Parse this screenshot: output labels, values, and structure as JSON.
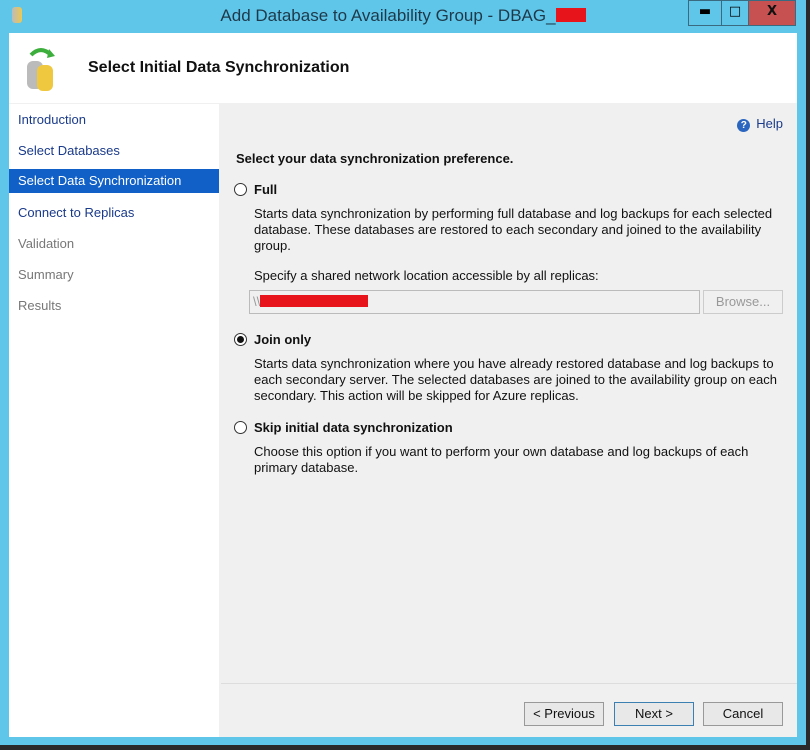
{
  "window": {
    "title": "Add Database to Availability Group - DBAG_",
    "minimize": "▬",
    "maximize": "□",
    "close": "X"
  },
  "header": {
    "title": "Select Initial Data Synchronization"
  },
  "nav": [
    "Introduction",
    "Select Databases",
    "Select Data Synchronization",
    "Connect to Replicas",
    "Validation",
    "Summary",
    "Results"
  ],
  "main": {
    "help": "Help",
    "prompt": "Select your data synchronization preference.",
    "full": {
      "label": "Full",
      "desc": "Starts data synchronization by performing full database and log backups for each selected database. These databases are restored to each secondary and joined to the availability group.",
      "share_label": "Specify a shared network location accessible by all replicas:",
      "share_value": "\\\\",
      "browse": "Browse..."
    },
    "join": {
      "label": "Join only",
      "desc": "Starts data synchronization where you have already restored database and log backups to each secondary server. The selected databases are joined to the availability group on each secondary. This action will be skipped for Azure replicas."
    },
    "skip": {
      "label": "Skip initial data synchronization",
      "desc": "Choose this option if you want to perform your own database and log backups of each primary database."
    }
  },
  "buttons": {
    "previous": "< Previous",
    "next": "Next >",
    "cancel": "Cancel"
  }
}
